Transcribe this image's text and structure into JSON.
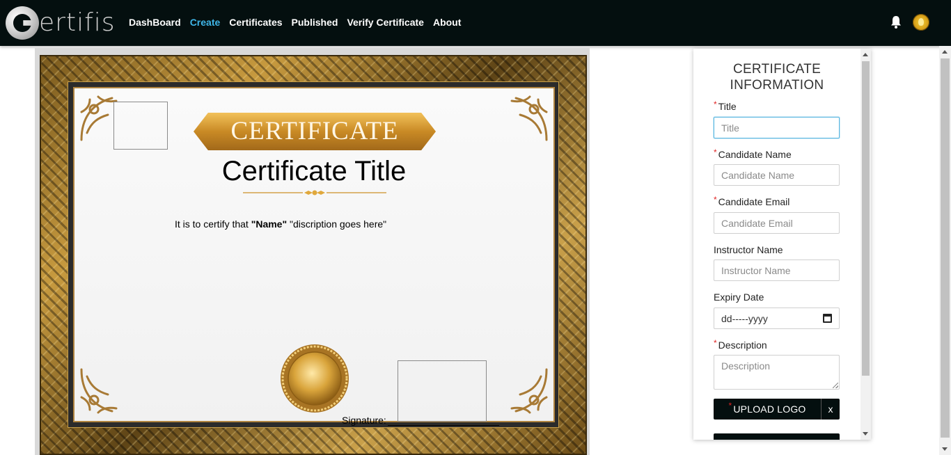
{
  "brand": {
    "name": "ertifis"
  },
  "nav": {
    "items": [
      {
        "label": "DashBoard",
        "active": false
      },
      {
        "label": "Create",
        "active": true
      },
      {
        "label": "Certificates",
        "active": false
      },
      {
        "label": "Published",
        "active": false
      },
      {
        "label": "Verify Certificate",
        "active": false
      },
      {
        "label": "About",
        "active": false
      }
    ],
    "accent_color": "#3fb6e8",
    "background_color": "#040f0f"
  },
  "icons": {
    "notifications": "bell-icon",
    "user": "avatar"
  },
  "certificate": {
    "banner": "CERTIFICATE",
    "title": "Certificate Title",
    "body_prefix": "It is to certify that ",
    "body_name": "\"Name\"",
    "body_suffix": " \"discription goes here\"",
    "signature_label": "Signature:"
  },
  "form": {
    "heading": "CERTIFICATE INFORMATION",
    "fields": {
      "title": {
        "label": "Title",
        "placeholder": "Title",
        "required": true
      },
      "candidate_name": {
        "label": "Candidate Name",
        "placeholder": "Candidate Name",
        "required": true
      },
      "candidate_email": {
        "label": "Candidate Email",
        "placeholder": "Candidate Email",
        "required": true
      },
      "instructor_name": {
        "label": "Instructor Name",
        "placeholder": "Instructor Name",
        "required": false
      },
      "expiry_date": {
        "label": "Expiry Date",
        "placeholder": "dd-----yyyy",
        "required": false
      },
      "description": {
        "label": "Description",
        "placeholder": "Description",
        "required": true
      }
    },
    "upload_logo": {
      "label": "UPLOAD LOGO",
      "clear": "x",
      "required": true
    }
  }
}
